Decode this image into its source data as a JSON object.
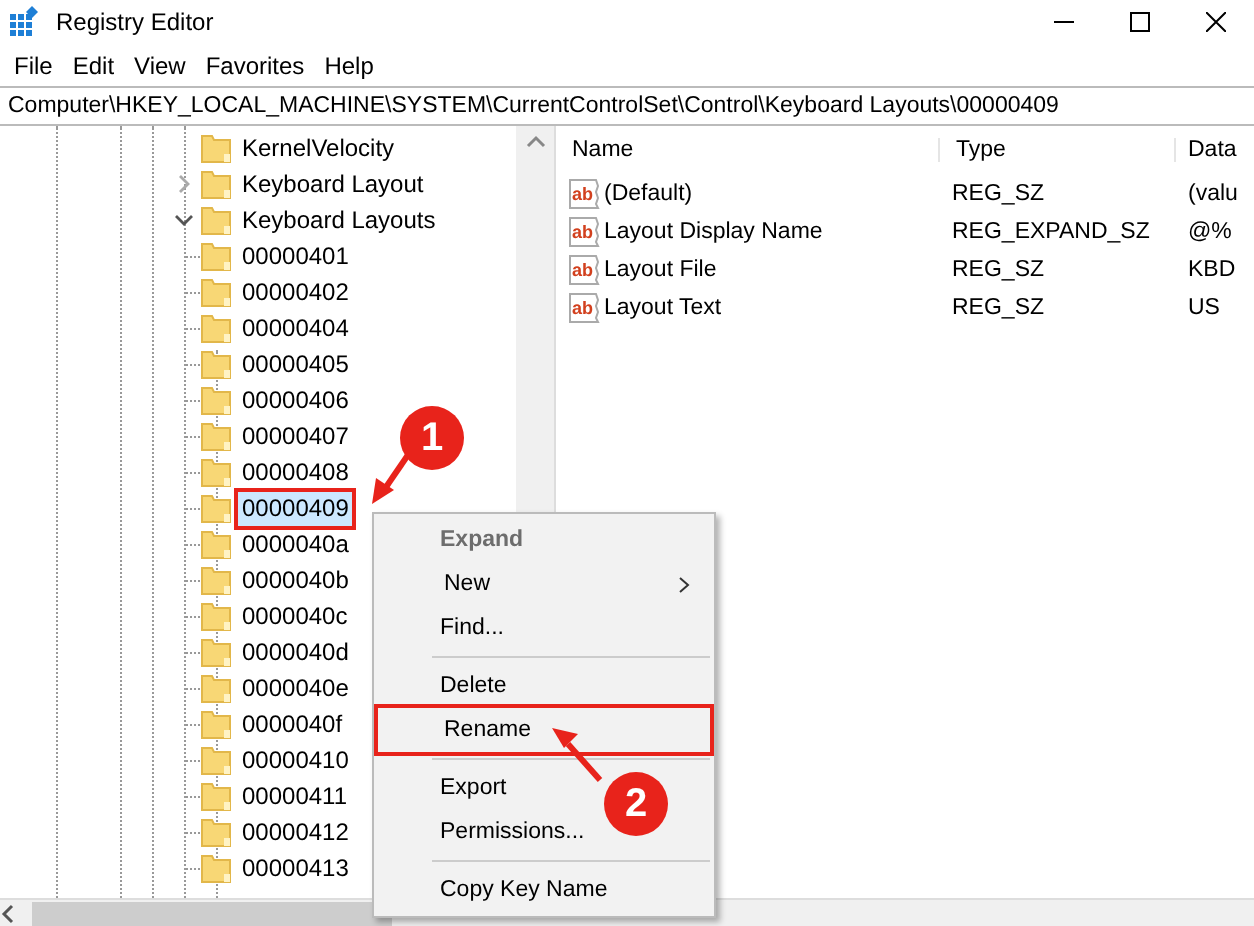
{
  "window": {
    "title": "Registry Editor"
  },
  "menu_bar": [
    "File",
    "Edit",
    "View",
    "Favorites",
    "Help"
  ],
  "address": "Computer\\HKEY_LOCAL_MACHINE\\SYSTEM\\CurrentControlSet\\Control\\Keyboard Layouts\\00000409",
  "tree": [
    {
      "label": "KernelVelocity",
      "selected": false,
      "marked": false
    },
    {
      "label": "Keyboard Layout",
      "selected": false,
      "marked": false,
      "expanded": false
    },
    {
      "label": "Keyboard Layouts",
      "selected": false,
      "marked": false,
      "expanded": true,
      "children": [
        {
          "label": "00000401",
          "selected": false,
          "marked": false
        },
        {
          "label": "00000402",
          "selected": false,
          "marked": false
        },
        {
          "label": "00000404",
          "selected": false,
          "marked": false
        },
        {
          "label": "00000405",
          "selected": false,
          "marked": false
        },
        {
          "label": "00000406",
          "selected": false,
          "marked": false
        },
        {
          "label": "00000407",
          "selected": false,
          "marked": false
        },
        {
          "label": "00000408",
          "selected": false,
          "marked": false
        },
        {
          "label": "00000409",
          "selected": true,
          "marked": true
        },
        {
          "label": "0000040a",
          "selected": false,
          "marked": false
        },
        {
          "label": "0000040b",
          "selected": false,
          "marked": false
        },
        {
          "label": "0000040c",
          "selected": false,
          "marked": false
        },
        {
          "label": "0000040d",
          "selected": false,
          "marked": false
        },
        {
          "label": "0000040e",
          "selected": false,
          "marked": false
        },
        {
          "label": "0000040f",
          "selected": false,
          "marked": false
        },
        {
          "label": "00000410",
          "selected": false,
          "marked": false
        },
        {
          "label": "00000411",
          "selected": false,
          "marked": false
        },
        {
          "label": "00000412",
          "selected": false,
          "marked": false
        },
        {
          "label": "00000413",
          "selected": false,
          "marked": false
        }
      ]
    }
  ],
  "table": {
    "columns": [
      "Name",
      "Type",
      "Data"
    ],
    "rows": [
      {
        "icon_label": "ab",
        "name": "(Default)",
        "type": "REG_SZ",
        "data": "(valu"
      },
      {
        "icon_label": "ab",
        "name": "Layout Display Name",
        "type": "REG_EXPAND_SZ",
        "data": "@%"
      },
      {
        "icon_label": "ab",
        "name": "Layout File",
        "type": "REG_SZ",
        "data": "KBD"
      },
      {
        "icon_label": "ab",
        "name": "Layout Text",
        "type": "REG_SZ",
        "data": "US"
      }
    ]
  },
  "context_menu": [
    {
      "kind": "item",
      "label": "Expand",
      "bold": true,
      "disabled": true,
      "submenu": false,
      "marked": false
    },
    {
      "kind": "item",
      "label": "New",
      "bold": false,
      "disabled": false,
      "submenu": true,
      "marked": false
    },
    {
      "kind": "item",
      "label": "Find...",
      "bold": false,
      "disabled": false,
      "submenu": false,
      "marked": false
    },
    {
      "kind": "separator"
    },
    {
      "kind": "item",
      "label": "Delete",
      "bold": false,
      "disabled": false,
      "submenu": false,
      "marked": false
    },
    {
      "kind": "item",
      "label": "Rename",
      "bold": false,
      "disabled": false,
      "submenu": false,
      "marked": true
    },
    {
      "kind": "separator"
    },
    {
      "kind": "item",
      "label": "Export",
      "bold": false,
      "disabled": false,
      "submenu": false,
      "marked": false
    },
    {
      "kind": "item",
      "label": "Permissions...",
      "bold": false,
      "disabled": false,
      "submenu": false,
      "marked": false
    },
    {
      "kind": "separator"
    },
    {
      "kind": "item",
      "label": "Copy Key Name",
      "bold": false,
      "disabled": false,
      "submenu": false,
      "marked": false
    }
  ],
  "annotations": [
    {
      "label": "1"
    },
    {
      "label": "2"
    }
  ]
}
